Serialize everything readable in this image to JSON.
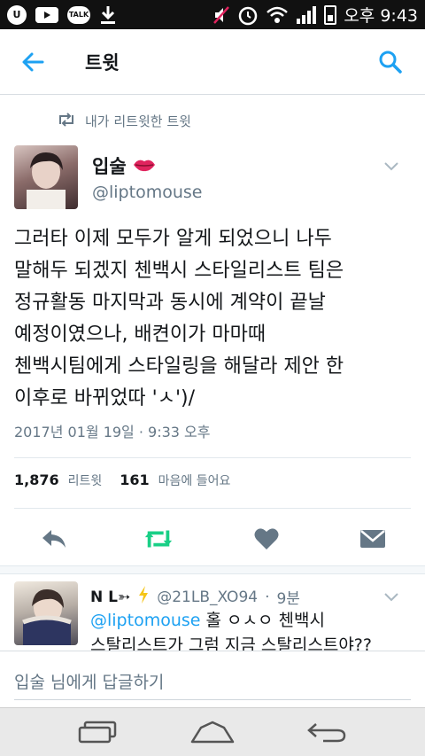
{
  "status_bar": {
    "left_icons": [
      "u-plus-icon",
      "youtube-icon",
      "talk-icon",
      "download-icon"
    ],
    "talk_label": "TALK",
    "right_icons": [
      "mute-icon",
      "alarm-icon",
      "wifi-icon",
      "signal-icon",
      "battery-icon"
    ],
    "time": "오후 9:43"
  },
  "header": {
    "title": "트윗",
    "back_icon": "back-arrow-icon",
    "search_icon": "search-icon"
  },
  "retweet_context": {
    "icon": "retweet-icon",
    "label": "내가 리트윗한 트윗"
  },
  "tweet": {
    "author_name": "입술",
    "author_handle": "@liptomouse",
    "text": "그러타 이제 모두가 알게 되었으니 나두\n말해두 되겠지 첸백시 스타일리스트 팀은\n정규활동 마지막과 동시에 계약이 끝날\n예정이였으나, 배켠이가 마마때\n첸백시팀에게 스타일링을 해달라 제안 한\n이후로 바뀌었따 'ㅅ')/",
    "timestamp": "2017년 01월 19일 · 9:33 오후",
    "retweets_count": "1,876",
    "retweets_label": "리트윗",
    "likes_count": "161",
    "likes_label": "마음에 들어요"
  },
  "actions": [
    "reply-icon",
    "retweet-icon",
    "like-icon",
    "dm-icon"
  ],
  "reply": {
    "name": "N L➳",
    "handle": "@21LB_XO94",
    "time": "9분",
    "mention": "@liptomouse",
    "text": " 홀 ㅇㅅㅇ 첸백시\n스탈리스트가 그럼 지금 스탈리스트야??"
  },
  "composer": {
    "placeholder": "입술 님에게 답글하기"
  },
  "colors": {
    "twitter_blue": "#1da1f2",
    "retweet_green": "#19cf86",
    "muted": "#657786",
    "lips_red": "#e0245e"
  }
}
